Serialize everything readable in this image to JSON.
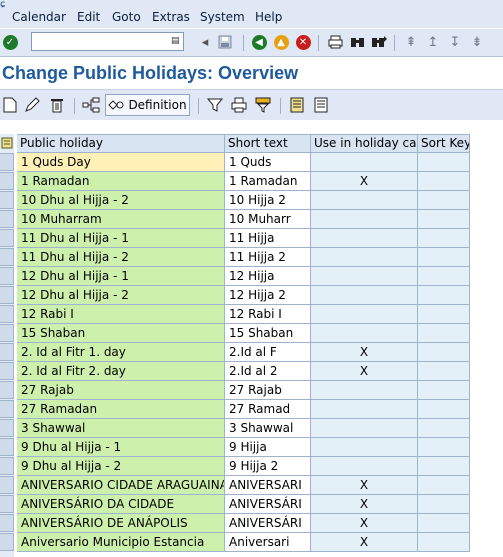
{
  "menu": {
    "items": [
      "Calendar",
      "Edit",
      "Goto",
      "Extras",
      "System",
      "Help"
    ]
  },
  "command_field": {
    "value": ""
  },
  "title": "Change Public Holidays: Overview",
  "app_toolbar": {
    "definition_label": "Definition"
  },
  "table": {
    "columns": [
      "Public holiday",
      "Short text",
      "Use in holiday cal.",
      "Sort Key"
    ],
    "rows": [
      {
        "name": "1 Quds Day",
        "short": "1 Quds",
        "use": "",
        "sort": ""
      },
      {
        "name": "1 Ramadan",
        "short": "1 Ramadan",
        "use": "X",
        "sort": ""
      },
      {
        "name": "10 Dhu al Hijja - 2",
        "short": "10 Hijja 2",
        "use": "",
        "sort": ""
      },
      {
        "name": "10 Muharram",
        "short": "10 Muharr",
        "use": "",
        "sort": ""
      },
      {
        "name": "11 Dhu al Hijja - 1",
        "short": "11 Hijja",
        "use": "",
        "sort": ""
      },
      {
        "name": "11 Dhu al Hijja - 2",
        "short": "11 Hijja 2",
        "use": "",
        "sort": ""
      },
      {
        "name": "12 Dhu al Hijja - 1",
        "short": "12 Hijja",
        "use": "",
        "sort": ""
      },
      {
        "name": "12 Dhu al Hijja - 2",
        "short": "12 Hijja 2",
        "use": "",
        "sort": ""
      },
      {
        "name": "12 Rabi I",
        "short": "12 Rabi I",
        "use": "",
        "sort": ""
      },
      {
        "name": "15 Shaban",
        "short": "15 Shaban",
        "use": "",
        "sort": ""
      },
      {
        "name": "2. Id al Fitr 1. day",
        "short": "2.Id al F",
        "use": "X",
        "sort": ""
      },
      {
        "name": "2. Id al Fitr 2. day",
        "short": "2.Id al 2",
        "use": "X",
        "sort": ""
      },
      {
        "name": "27 Rajab",
        "short": "27 Rajab",
        "use": "",
        "sort": ""
      },
      {
        "name": "27 Ramadan",
        "short": "27 Ramad",
        "use": "",
        "sort": ""
      },
      {
        "name": "3 Shawwal",
        "short": "3 Shawwal",
        "use": "",
        "sort": ""
      },
      {
        "name": "9 Dhu al Hijja - 1",
        "short": "9 Hijja",
        "use": "",
        "sort": ""
      },
      {
        "name": "9 Dhu al Hijja - 2",
        "short": "9 Hijja 2",
        "use": "",
        "sort": ""
      },
      {
        "name": "ANIVERSARIO CIDADE ARAGUAINA",
        "short": "ANIVERSARI",
        "use": "X",
        "sort": ""
      },
      {
        "name": "ANIVERSÁRIO DA CIDADE",
        "short": "ANIVERSÁRI",
        "use": "X",
        "sort": ""
      },
      {
        "name": "ANIVERSÁRIO DE ANÁPOLIS",
        "short": "ANIVERSÁRI",
        "use": "X",
        "sort": ""
      },
      {
        "name": "Aniversario Municipio Estancia",
        "short": "Aniversari",
        "use": "X",
        "sort": ""
      }
    ]
  },
  "colors": {
    "menubar_bg": "#dfe8f4",
    "title_text": "#1f5a9e",
    "name_cell_bg": "#cdf0ac",
    "selected_cell_bg": "#fff0b8",
    "use_cell_bg": "#e4f0f8"
  }
}
